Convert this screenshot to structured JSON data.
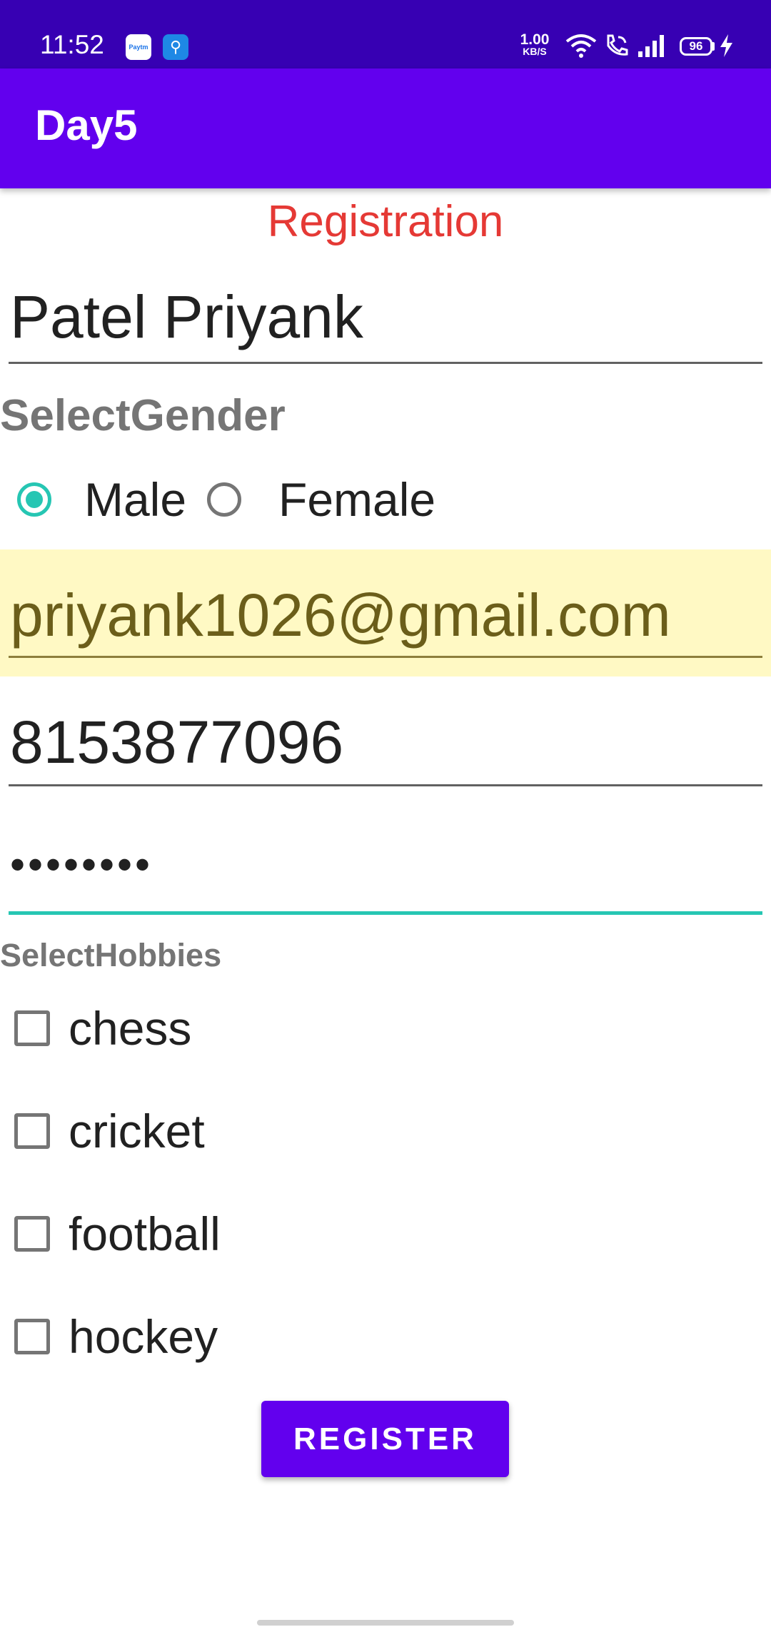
{
  "status_bar": {
    "time": "11:52",
    "paytm_icon_text": "Paytm",
    "net_speed_value": "1.00",
    "net_speed_unit": "KB/S",
    "battery_level": "96",
    "icons": [
      "paytm-icon",
      "usb-icon",
      "wifi-icon",
      "wifi-calling-icon",
      "signal-icon",
      "battery-icon",
      "charging-icon"
    ]
  },
  "app_bar": {
    "title": "Day5",
    "color": "#6200ee"
  },
  "form": {
    "heading": "Registration",
    "name_value": "Patel Priyank",
    "gender_label": "SelectGender",
    "gender_options": [
      {
        "label": "Male",
        "checked": true
      },
      {
        "label": "Female",
        "checked": false
      }
    ],
    "email_value": "priyank1026@gmail.com",
    "phone_value": "8153877096",
    "password_value": "••••••••",
    "hobbies_label": "SelectHobbies",
    "hobbies": [
      {
        "label": "chess",
        "checked": false
      },
      {
        "label": "cricket",
        "checked": false
      },
      {
        "label": "football",
        "checked": false
      },
      {
        "label": "hockey",
        "checked": false
      }
    ],
    "register_label": "REGISTER"
  },
  "colors": {
    "status_bar": "#3700b3",
    "primary": "#6200ee",
    "accent": "#26c6b3",
    "heading": "#e53935",
    "email_highlight": "#fff9c4"
  }
}
